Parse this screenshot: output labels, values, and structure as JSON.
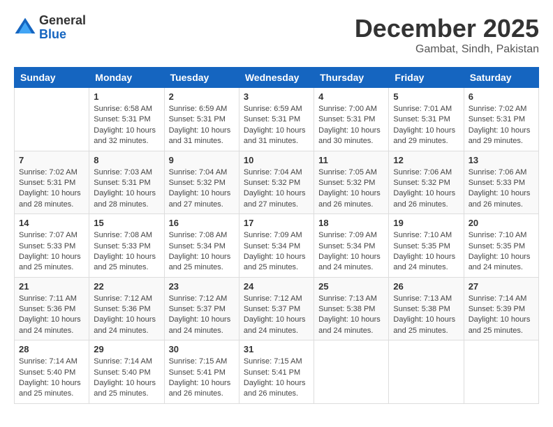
{
  "logo": {
    "general": "General",
    "blue": "Blue"
  },
  "title": {
    "month": "December 2025",
    "location": "Gambat, Sindh, Pakistan"
  },
  "days_of_week": [
    "Sunday",
    "Monday",
    "Tuesday",
    "Wednesday",
    "Thursday",
    "Friday",
    "Saturday"
  ],
  "weeks": [
    [
      {
        "day": "",
        "info": ""
      },
      {
        "day": "1",
        "info": "Sunrise: 6:58 AM\nSunset: 5:31 PM\nDaylight: 10 hours\nand 32 minutes."
      },
      {
        "day": "2",
        "info": "Sunrise: 6:59 AM\nSunset: 5:31 PM\nDaylight: 10 hours\nand 31 minutes."
      },
      {
        "day": "3",
        "info": "Sunrise: 6:59 AM\nSunset: 5:31 PM\nDaylight: 10 hours\nand 31 minutes."
      },
      {
        "day": "4",
        "info": "Sunrise: 7:00 AM\nSunset: 5:31 PM\nDaylight: 10 hours\nand 30 minutes."
      },
      {
        "day": "5",
        "info": "Sunrise: 7:01 AM\nSunset: 5:31 PM\nDaylight: 10 hours\nand 29 minutes."
      },
      {
        "day": "6",
        "info": "Sunrise: 7:02 AM\nSunset: 5:31 PM\nDaylight: 10 hours\nand 29 minutes."
      }
    ],
    [
      {
        "day": "7",
        "info": "Sunrise: 7:02 AM\nSunset: 5:31 PM\nDaylight: 10 hours\nand 28 minutes."
      },
      {
        "day": "8",
        "info": "Sunrise: 7:03 AM\nSunset: 5:31 PM\nDaylight: 10 hours\nand 28 minutes."
      },
      {
        "day": "9",
        "info": "Sunrise: 7:04 AM\nSunset: 5:32 PM\nDaylight: 10 hours\nand 27 minutes."
      },
      {
        "day": "10",
        "info": "Sunrise: 7:04 AM\nSunset: 5:32 PM\nDaylight: 10 hours\nand 27 minutes."
      },
      {
        "day": "11",
        "info": "Sunrise: 7:05 AM\nSunset: 5:32 PM\nDaylight: 10 hours\nand 26 minutes."
      },
      {
        "day": "12",
        "info": "Sunrise: 7:06 AM\nSunset: 5:32 PM\nDaylight: 10 hours\nand 26 minutes."
      },
      {
        "day": "13",
        "info": "Sunrise: 7:06 AM\nSunset: 5:33 PM\nDaylight: 10 hours\nand 26 minutes."
      }
    ],
    [
      {
        "day": "14",
        "info": "Sunrise: 7:07 AM\nSunset: 5:33 PM\nDaylight: 10 hours\nand 25 minutes."
      },
      {
        "day": "15",
        "info": "Sunrise: 7:08 AM\nSunset: 5:33 PM\nDaylight: 10 hours\nand 25 minutes."
      },
      {
        "day": "16",
        "info": "Sunrise: 7:08 AM\nSunset: 5:34 PM\nDaylight: 10 hours\nand 25 minutes."
      },
      {
        "day": "17",
        "info": "Sunrise: 7:09 AM\nSunset: 5:34 PM\nDaylight: 10 hours\nand 25 minutes."
      },
      {
        "day": "18",
        "info": "Sunrise: 7:09 AM\nSunset: 5:34 PM\nDaylight: 10 hours\nand 24 minutes."
      },
      {
        "day": "19",
        "info": "Sunrise: 7:10 AM\nSunset: 5:35 PM\nDaylight: 10 hours\nand 24 minutes."
      },
      {
        "day": "20",
        "info": "Sunrise: 7:10 AM\nSunset: 5:35 PM\nDaylight: 10 hours\nand 24 minutes."
      }
    ],
    [
      {
        "day": "21",
        "info": "Sunrise: 7:11 AM\nSunset: 5:36 PM\nDaylight: 10 hours\nand 24 minutes."
      },
      {
        "day": "22",
        "info": "Sunrise: 7:12 AM\nSunset: 5:36 PM\nDaylight: 10 hours\nand 24 minutes."
      },
      {
        "day": "23",
        "info": "Sunrise: 7:12 AM\nSunset: 5:37 PM\nDaylight: 10 hours\nand 24 minutes."
      },
      {
        "day": "24",
        "info": "Sunrise: 7:12 AM\nSunset: 5:37 PM\nDaylight: 10 hours\nand 24 minutes."
      },
      {
        "day": "25",
        "info": "Sunrise: 7:13 AM\nSunset: 5:38 PM\nDaylight: 10 hours\nand 24 minutes."
      },
      {
        "day": "26",
        "info": "Sunrise: 7:13 AM\nSunset: 5:38 PM\nDaylight: 10 hours\nand 25 minutes."
      },
      {
        "day": "27",
        "info": "Sunrise: 7:14 AM\nSunset: 5:39 PM\nDaylight: 10 hours\nand 25 minutes."
      }
    ],
    [
      {
        "day": "28",
        "info": "Sunrise: 7:14 AM\nSunset: 5:40 PM\nDaylight: 10 hours\nand 25 minutes."
      },
      {
        "day": "29",
        "info": "Sunrise: 7:14 AM\nSunset: 5:40 PM\nDaylight: 10 hours\nand 25 minutes."
      },
      {
        "day": "30",
        "info": "Sunrise: 7:15 AM\nSunset: 5:41 PM\nDaylight: 10 hours\nand 26 minutes."
      },
      {
        "day": "31",
        "info": "Sunrise: 7:15 AM\nSunset: 5:41 PM\nDaylight: 10 hours\nand 26 minutes."
      },
      {
        "day": "",
        "info": ""
      },
      {
        "day": "",
        "info": ""
      },
      {
        "day": "",
        "info": ""
      }
    ]
  ]
}
